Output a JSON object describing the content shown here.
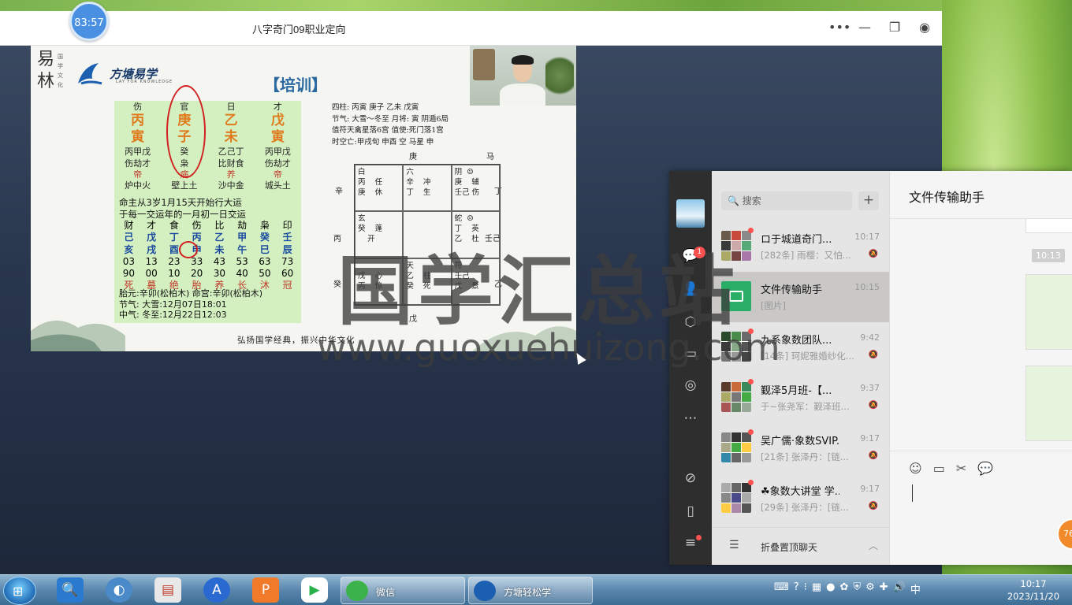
{
  "meeting": {
    "timer": "83:57",
    "title": "八字奇门09职业定向",
    "controls": [
      "more-icon",
      "minimize-icon",
      "restore-icon",
      "record-icon"
    ]
  },
  "slide": {
    "logo_mark": "易林",
    "logo_small": "国学文化",
    "brand_name": "方塘易学",
    "brand_sub": "LAY FOR KNOWLEDGE",
    "training": "【培训】",
    "pillars": {
      "gods": [
        "伤",
        "官",
        "日",
        "才"
      ],
      "stems": [
        "丙",
        "庚",
        "乙",
        "戊"
      ],
      "branches": [
        "寅",
        "子",
        "未",
        "寅"
      ],
      "hidden": [
        "丙甲戊",
        "癸",
        "乙己丁",
        "丙甲戊"
      ],
      "hidden_gods": [
        "伤劫才",
        "枭",
        "比财食",
        "伤劫才"
      ],
      "stages": [
        "帝",
        "病",
        "养",
        "帝"
      ],
      "nayin": [
        "炉中火",
        "壁上土",
        "沙中金",
        "城头土"
      ]
    },
    "luck_line1": "命主从3岁1月15天开始行大运",
    "luck_line2": "于每一交运年的一月初一日交运",
    "luck_gods": [
      "财",
      "才",
      "食",
      "伤",
      "比",
      "劫",
      "枭",
      "印"
    ],
    "luck_stems": [
      "己",
      "戊",
      "丁",
      "丙",
      "乙",
      "甲",
      "癸",
      "壬"
    ],
    "luck_branches": [
      "亥",
      "戌",
      "酉",
      "申",
      "未",
      "午",
      "巳",
      "辰"
    ],
    "luck_ages": [
      "03",
      "13",
      "23",
      "33",
      "43",
      "53",
      "63",
      "73"
    ],
    "luck_ages2": [
      "90",
      "00",
      "10",
      "20",
      "30",
      "40",
      "50",
      "60"
    ],
    "luck_stages": [
      "死",
      "墓",
      "绝",
      "胎",
      "养",
      "长",
      "沐",
      "冠"
    ],
    "foot1": "胎元:辛卯(松柏木) 命宫:辛卯(松柏木)",
    "foot2": "节气:  大雪:12月07日18:01",
    "foot3": "中气:  冬至:12月22日12:03",
    "slogan": "弘扬国学经典，振兴中华文化",
    "qimen": {
      "info1": "四柱: 丙寅    庚子    乙未    戊寅",
      "info2": "节气: 大雪～冬至        月将: 寅    阴遁6局",
      "info3": "值符天禽星落6宫  值使:死门落1宫",
      "info4": "时空亡:甲戌旬  申酉  空  马星  申",
      "top": "庚",
      "top_right": "马",
      "left1": "辛",
      "right1": "丁",
      "left2": "丙",
      "right2": "壬己",
      "left3": "癸",
      "right3": "乙",
      "bottom": "戊",
      "cells": [
        "白\n丙    任\n庚    休",
        "六\n辛    冲\n丁    生",
        "阴  ☺\n庚    辅\n壬己 伤",
        "玄\n癸    蓬\n    开",
        "",
        "蛇  ☺\n丁    英\n乙    杜",
        "\n戊    心\n丙    惊",
        "天\n乙    柱\n癸    死",
        "符\n壬己\n戊    景"
      ]
    }
  },
  "watermark": {
    "big": "国学汇总站",
    "url": "www.guoxuehuizong.com"
  },
  "wechat": {
    "badge": "1",
    "search_placeholder": "搜索",
    "chats": [
      {
        "name": "ロ于城道奇门...",
        "time": "10:17",
        "preview": "[282条] 雨樱：又怕..."
      },
      {
        "name": "文件传输助手",
        "time": "10:15",
        "preview": "[图片]"
      },
      {
        "name": "九系象数团队...",
        "time": "9:42",
        "preview": "[14条] 珂妮雅婚纱化..."
      },
      {
        "name": "觐泽5月班-【...",
        "time": "9:37",
        "preview": "于~张尧军：觐泽班..."
      },
      {
        "name": "吴广儒·象数SVIP...",
        "time": "9:17",
        "preview": "[21条] 张泽丹：[链..."
      },
      {
        "name": "☘象数大讲堂 学...",
        "time": "9:17",
        "preview": "[29条] 张泽丹：[链..."
      }
    ],
    "fold_label": "折叠置顶聊天",
    "chat_title": "文件传输助手",
    "timestamp": "10:13"
  },
  "float_ball": "76",
  "taskbar": {
    "tasks": [
      "微信",
      "方塘轻松学"
    ],
    "clock_time": "10:17",
    "clock_date": "2023/11/20"
  }
}
